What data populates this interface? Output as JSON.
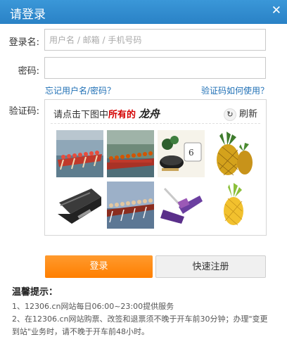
{
  "header": {
    "title": "请登录",
    "close_glyph": "✕"
  },
  "form": {
    "username_label": "登录名:",
    "username_placeholder": "用户名 / 邮箱 / 手机号码",
    "password_label": "密码:",
    "password_value": "",
    "forgot_link": "忘记用户名/密码？",
    "captcha_help_link": "验证码如何使用？",
    "captcha_label": "验证码:"
  },
  "captcha": {
    "prompt_before": "请点击下图中",
    "prompt_highlight": "所有的",
    "prompt_target": "龙舟",
    "refresh_label": "刷新",
    "tiles": [
      {
        "name": "dragon-boat-race-1",
        "icon": "dragon-boat"
      },
      {
        "name": "dragon-boat-race-2",
        "icon": "dragon-boat"
      },
      {
        "name": "caviar-tin",
        "icon": "caviar"
      },
      {
        "name": "pineapples",
        "icon": "pineapple"
      },
      {
        "name": "stapler",
        "icon": "stapler"
      },
      {
        "name": "dragon-boat-race-3",
        "icon": "dragon-boat"
      },
      {
        "name": "mop",
        "icon": "mop"
      },
      {
        "name": "pineapple",
        "icon": "pineapple"
      }
    ]
  },
  "buttons": {
    "login": "登录",
    "register": "快速注册"
  },
  "tips": {
    "title": "温馨提示：",
    "line1": "1、12306.cn网站每日06:00~23:00提供服务",
    "line2": "2、在12306.cn网站购票、改签和退票须不晚于开车前30分钟；办理\"变更",
    "line3": "到站\"业务时，请不晚于开车前48小时。"
  },
  "colors": {
    "header": "#2f8ad0",
    "link": "#1e6fb5",
    "primary": "#ff8a00",
    "highlight": "#d40000"
  }
}
